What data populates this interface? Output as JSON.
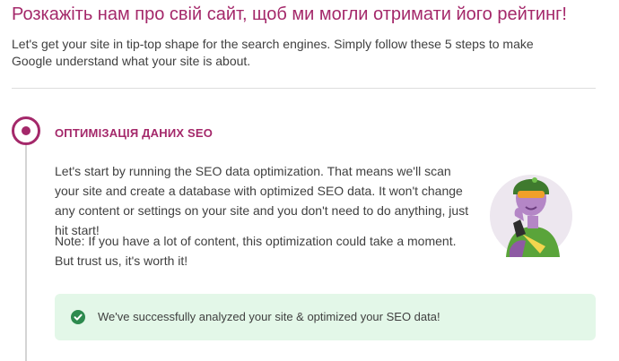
{
  "header": {
    "title": "Розкажіть нам про свій сайт, щоб ми могли отримати його рейтинг!",
    "intro": "Let's get your site in tip-top shape for the search engines. Simply follow these 5 steps to make Google understand what your site is about."
  },
  "step": {
    "title": "ОПТИМІЗАЦІЯ ДАНИХ SEO",
    "paragraph_1": "Let's start by running the SEO data optimization. That means we'll scan your site and create a database with optimized SEO data. It won't change any content or settings on your site and you don't need to do anything, just hit start!",
    "paragraph_2": "Note: If you have a lot of content, this optimization could take a moment. But trust us, it's worth it!",
    "illustration_icon": "character-with-helmet-illustration"
  },
  "status": {
    "message": "We've successfully analyzed your site & optimized your SEO data!",
    "icon": "check-circle-icon"
  },
  "colors": {
    "accent": "#a4286a",
    "success_bg": "#e3f7e8",
    "success_icon": "#2d8a4e"
  }
}
